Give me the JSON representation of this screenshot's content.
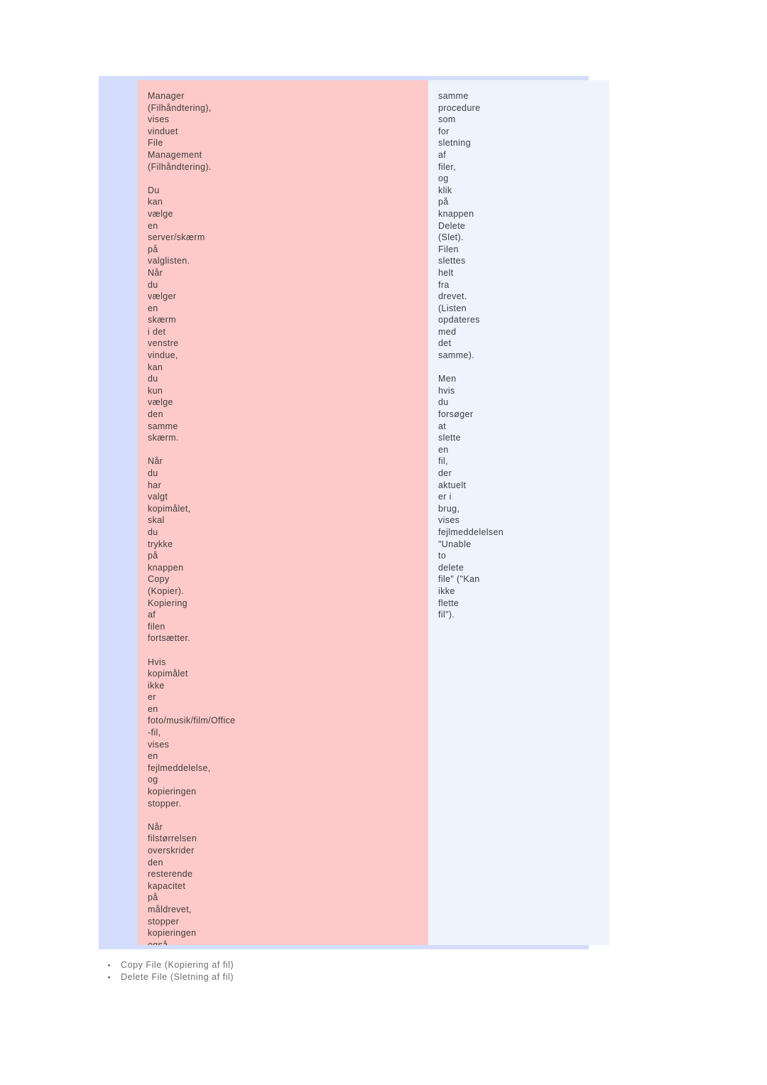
{
  "document": {
    "language": "Danish",
    "colors": {
      "panel_background": "#d4ddfb",
      "left_cell_background": "#fdc9c9",
      "right_cell_background": "#edf4fe",
      "body_text": "#3c3c3c",
      "link_text": "#6d6d6d",
      "page_background": "#ffffff"
    }
  },
  "content": {
    "left_column": {
      "paragraphs": [
        "Manager\n(Filhåndtering),\nvises\nvinduet\nFile\nManagement\n(Filhåndtering).",
        "Du\nkan\nvælge\nen\nserver/skærm\npå\nvalglisten.\nNår\ndu\nvælger\nen\nskærm\ni det\nvenstre\nvindue,\nkan\ndu\nkun\nvælge\nden\nsamme\nskærm.",
        "Når\ndu\nhar\nvalgt\nkopimålet,\nskal\ndu\ntrykke\npå\nknappen\nCopy\n(Kopier).\nKopiering\naf\nfilen\nfortsætter.",
        "Hvis\nkopimålet\nikke\ner\nen\nfoto/musik/film/Office\n-fil,\nvises\nen\nfejlmeddelelse,\nog\nkopieringen\nstopper.",
        "Når\nfilstørrelsen\noverskrider\nden\nresterende\nkapacitet\npå\nmåldrevet,\nstopper\nkopieringen\nogså."
      ]
    },
    "right_column": {
      "paragraphs": [
        "samme\nprocedure\nsom\nfor\nsletning\naf\nfiler,\nog\nklik\npå\nknappen\nDelete\n(Slet).\nFilen\nslettes\nhelt\nfra\ndrevet.\n(Listen\nopdateres\nmed\ndet\nsamme).",
        "Men\nhvis\ndu\nforsøger\nat\nslette\nen\nfil,\nder\naktuelt\ner i\nbrug,\nvises\nfejlmeddelelsen\n\"Unable\nto\ndelete\nfile\" (\"Kan\nikke\nflette\nfil\")."
      ]
    }
  },
  "link_list": {
    "items": [
      "Copy File (Kopiering af fil)",
      "Delete File (Sletning af fil)"
    ]
  }
}
